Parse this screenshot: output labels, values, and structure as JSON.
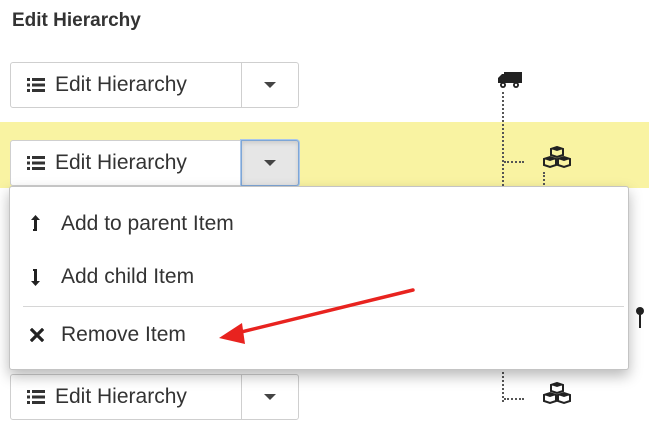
{
  "page": {
    "title": "Edit Hierarchy"
  },
  "rows": [
    {
      "button_label": "Edit Hierarchy",
      "tree_icon": "truck-icon"
    },
    {
      "button_label": "Edit Hierarchy",
      "tree_icon": "boxes-icon",
      "highlighted": true,
      "dropdown_open": true
    },
    {
      "button_label": "Edit Hierarchy",
      "tree_icon": "boxes-icon"
    }
  ],
  "dropdown": {
    "items": [
      {
        "label": "Add to parent Item",
        "icon": "arrow-up-icon"
      },
      {
        "label": "Add child Item",
        "icon": "arrow-down-icon"
      },
      {
        "label": "Remove Item",
        "icon": "close-icon"
      }
    ]
  },
  "annotation": {
    "color": "#e8231f",
    "target": "Remove Item"
  },
  "colors": {
    "highlight": "#f9f3a2",
    "text": "#333333",
    "border": "#cfcfcf",
    "active_border": "#7ea6d6"
  }
}
